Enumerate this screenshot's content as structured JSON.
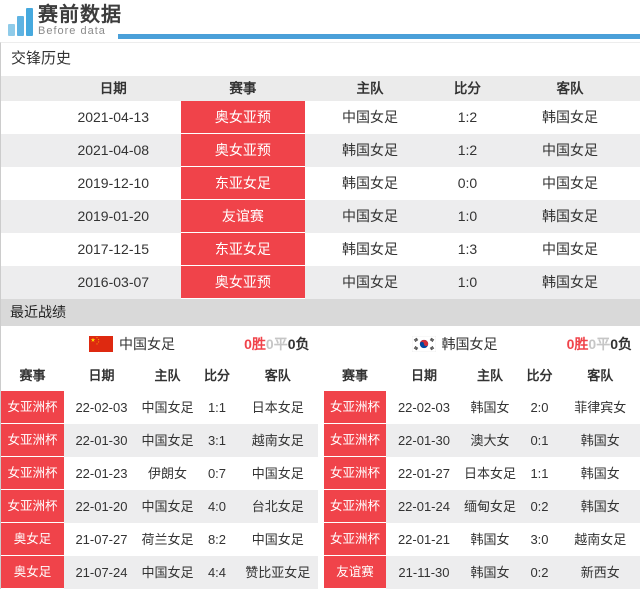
{
  "header": {
    "logo_title": "赛前数据",
    "logo_subtitle": "Before data",
    "accent_blue": "#4aa0d9",
    "logo_blue": "#46a9de",
    "accent_red": "#f0434a"
  },
  "h2h": {
    "section_title": "交锋历史",
    "columns": [
      "日期",
      "赛事",
      "主队",
      "比分",
      "客队"
    ],
    "rows": [
      {
        "date": "2021-04-13",
        "comp": "奥女亚预",
        "home": "中国女足",
        "score": "1:2",
        "away": "韩国女足"
      },
      {
        "date": "2021-04-08",
        "comp": "奥女亚预",
        "home": "韩国女足",
        "score": "1:2",
        "away": "中国女足"
      },
      {
        "date": "2019-12-10",
        "comp": "东亚女足",
        "home": "韩国女足",
        "score": "0:0",
        "away": "中国女足"
      },
      {
        "date": "2019-01-20",
        "comp": "友谊赛",
        "home": "中国女足",
        "score": "1:0",
        "away": "韩国女足"
      },
      {
        "date": "2017-12-15",
        "comp": "东亚女足",
        "home": "韩国女足",
        "score": "1:3",
        "away": "中国女足"
      },
      {
        "date": "2016-03-07",
        "comp": "奥女亚预",
        "home": "中国女足",
        "score": "1:0",
        "away": "韩国女足"
      }
    ]
  },
  "recent": {
    "section_title": "最近战绩",
    "columns": [
      "赛事",
      "日期",
      "主队",
      "比分",
      "客队"
    ],
    "left": {
      "team": "中国女足",
      "flag_icon": "china-flag",
      "record": {
        "wins": "0胜",
        "draws": "0平",
        "losses": "0负"
      },
      "rows": [
        {
          "comp": "女亚洲杯",
          "date": "22-02-03",
          "home": "中国女足",
          "score": "1:1",
          "away": "日本女足"
        },
        {
          "comp": "女亚洲杯",
          "date": "22-01-30",
          "home": "中国女足",
          "score": "3:1",
          "away": "越南女足"
        },
        {
          "comp": "女亚洲杯",
          "date": "22-01-23",
          "home": "伊朗女",
          "score": "0:7",
          "away": "中国女足"
        },
        {
          "comp": "女亚洲杯",
          "date": "22-01-20",
          "home": "中国女足",
          "score": "4:0",
          "away": "台北女足"
        },
        {
          "comp": "奥女足",
          "date": "21-07-27",
          "home": "荷兰女足",
          "score": "8:2",
          "away": "中国女足"
        },
        {
          "comp": "奥女足",
          "date": "21-07-24",
          "home": "中国女足",
          "score": "4:4",
          "away": "赞比亚女足"
        }
      ]
    },
    "right": {
      "team": "韩国女足",
      "flag_icon": "south-korea-flag",
      "record": {
        "wins": "0胜",
        "draws": "0平",
        "losses": "0负"
      },
      "rows": [
        {
          "comp": "女亚洲杯",
          "date": "22-02-03",
          "home": "韩国女",
          "score": "2:0",
          "away": "菲律宾女"
        },
        {
          "comp": "女亚洲杯",
          "date": "22-01-30",
          "home": "澳大女",
          "score": "0:1",
          "away": "韩国女"
        },
        {
          "comp": "女亚洲杯",
          "date": "22-01-27",
          "home": "日本女足",
          "score": "1:1",
          "away": "韩国女"
        },
        {
          "comp": "女亚洲杯",
          "date": "22-01-24",
          "home": "缅甸女足",
          "score": "0:2",
          "away": "韩国女"
        },
        {
          "comp": "女亚洲杯",
          "date": "22-01-21",
          "home": "韩国女",
          "score": "3:0",
          "away": "越南女足"
        },
        {
          "comp": "友谊赛",
          "date": "21-11-30",
          "home": "韩国女",
          "score": "0:2",
          "away": "新西女"
        }
      ]
    }
  }
}
